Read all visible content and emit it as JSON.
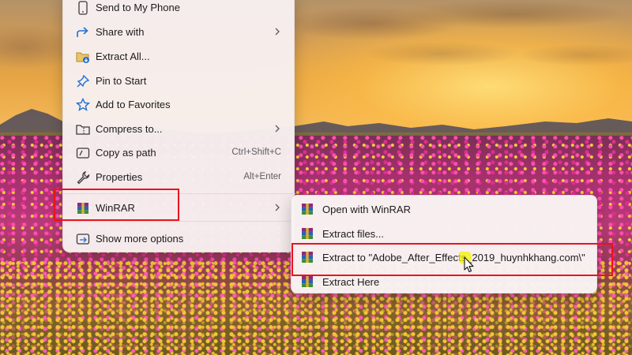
{
  "colors": {
    "menu_background": "#f7f0f0",
    "text": "#1b1b1b",
    "shortcut_text": "#5e5e5e",
    "icon_accent": "#1f6fd1",
    "highlight_box": "#e8141c",
    "cursor_halo": "#f4f200"
  },
  "context_menu": {
    "items": [
      {
        "label": "Send to My Phone",
        "icon": "phone-icon"
      },
      {
        "label": "Share with",
        "icon": "share-icon",
        "has_submenu": true
      },
      {
        "label": "Extract All...",
        "icon": "extract-all-icon"
      },
      {
        "label": "Pin to Start",
        "icon": "pin-icon"
      },
      {
        "label": "Add to Favorites",
        "icon": "star-icon"
      },
      {
        "label": "Compress to...",
        "icon": "zip-folder-icon",
        "has_submenu": true
      },
      {
        "label": "Copy as path",
        "icon": "copy-path-icon",
        "shortcut": "Ctrl+Shift+C"
      },
      {
        "label": "Properties",
        "icon": "wrench-icon",
        "shortcut": "Alt+Enter"
      },
      {
        "label": "WinRAR",
        "icon": "winrar-icon",
        "has_submenu": true,
        "highlighted": true
      },
      {
        "label": "Show more options",
        "icon": "show-more-icon"
      }
    ]
  },
  "winrar_submenu": {
    "items": [
      {
        "label": "Open with WinRAR",
        "icon": "winrar-icon"
      },
      {
        "label": "Extract files...",
        "icon": "winrar-icon"
      },
      {
        "label": "Extract to \"Adobe_After_Effects_2019_huynhkhang.com\\\"",
        "icon": "winrar-icon",
        "highlighted": true,
        "hovered": true
      },
      {
        "label": "Extract Here",
        "icon": "winrar-icon"
      }
    ]
  }
}
